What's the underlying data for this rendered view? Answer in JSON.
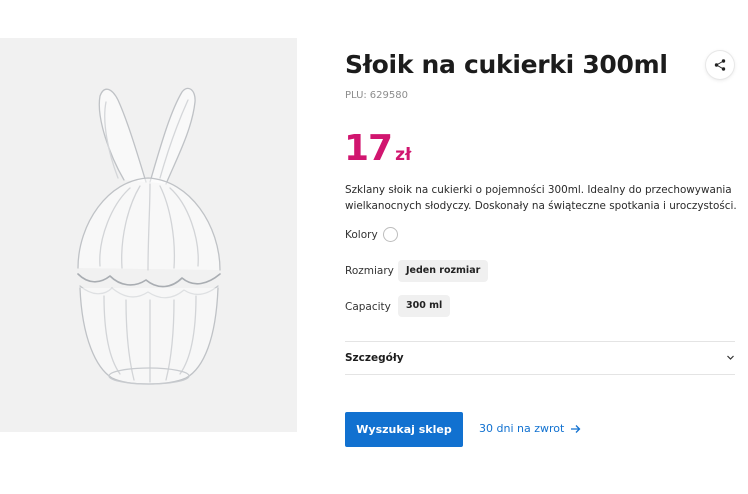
{
  "product": {
    "title": "Słoik na cukierki 300ml",
    "plu_label": "PLU:",
    "plu_value": "629580",
    "price_value": "17",
    "price_currency": "zł",
    "description": "Szklany słoik na cukierki o pojemności 300ml. Idealny do przechowywania wielkanocnych słodyczy. Doskonały na świąteczne spotkania i uroczystości.",
    "image_alt": "Szklany słoik w kształcie zająca"
  },
  "options": {
    "colors_label": "Kolory",
    "sizes_label": "Rozmiary",
    "size_value": "Jeden rozmiar",
    "capacity_label": "Capacity",
    "capacity_value": "300 ml"
  },
  "details": {
    "label": "Szczegóły"
  },
  "actions": {
    "find_store_label": "Wyszukaj sklep",
    "return_label": "30 dni na zwrot"
  },
  "icons": {
    "share": "share-icon",
    "chevron": "chevron-down-icon",
    "arrow": "arrow-right-icon"
  },
  "colors": {
    "price": "#d1156f",
    "primary_button": "#1171d0",
    "link": "#1171d0",
    "gallery_bg": "#f1f1f1"
  }
}
